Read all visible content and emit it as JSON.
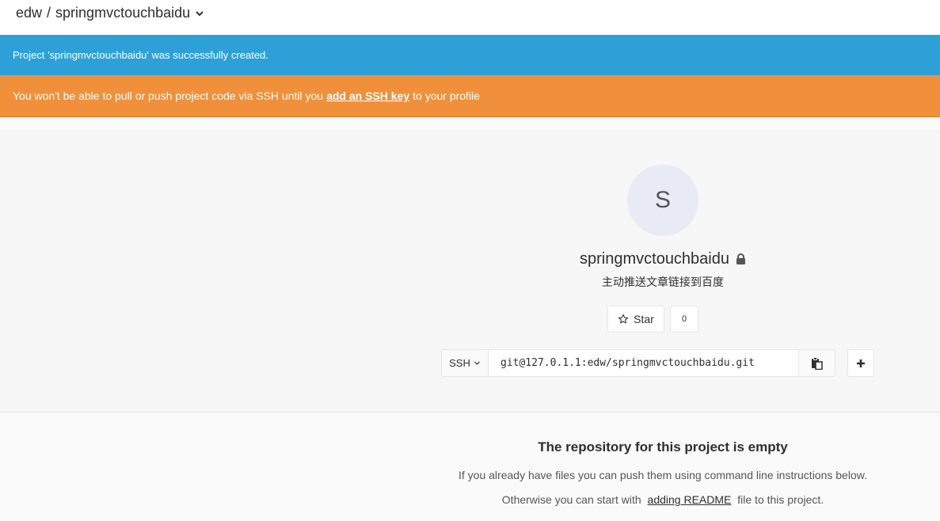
{
  "header": {
    "namespace": "edw",
    "separator": "/",
    "project": "springmvctouchbaidu"
  },
  "flash": {
    "notice": "Project 'springmvctouchbaidu' was successfully created.",
    "warning_before": "You won't be able to pull or push project code via SSH until you",
    "warning_link": "add an SSH key",
    "warning_after": "to your profile"
  },
  "project": {
    "avatar_letter": "S",
    "name": "springmvctouchbaidu",
    "description": "主动推送文章链接到百度",
    "star_label": "Star",
    "star_count": "0"
  },
  "clone": {
    "protocol": "SSH",
    "url": "git@127.0.1.1:edw/springmvctouchbaidu.git"
  },
  "empty": {
    "title": "The repository for this project is empty",
    "line1": "If you already have files you can push them using command line instructions below.",
    "line2_before": "Otherwise you can start with",
    "line2_link": "adding README",
    "line2_after": "file to this project."
  },
  "colors": {
    "notice_bg": "#2ea0d8",
    "warning_bg": "#f0903a"
  }
}
